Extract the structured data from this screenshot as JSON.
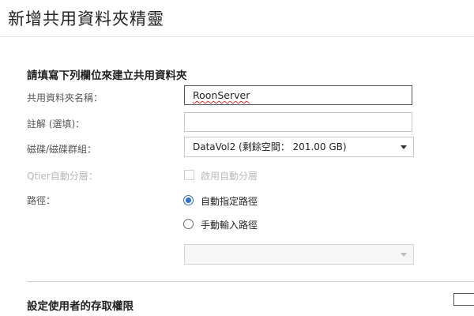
{
  "window": {
    "title": "新增共用資料夾精靈"
  },
  "form": {
    "section_title": "請填寫下列欄位來建立共用資料夾",
    "folder_name": {
      "label": "共用資料夾名稱：",
      "value": "RoonServer"
    },
    "comment": {
      "label": "註解 (選填)：",
      "value": ""
    },
    "disk": {
      "label": "磁碟/磁碟群組：",
      "selected": "DataVol2 (剩餘空間： 201.00 GB)"
    },
    "qtier": {
      "label": "Qtier自動分層：",
      "checkbox_label": "啟用自動分層",
      "checked": false,
      "enabled": false
    },
    "path": {
      "label": "路徑：",
      "options": [
        {
          "label": "自動指定路徑",
          "selected": true
        },
        {
          "label": "手動輸入路徑",
          "selected": false
        }
      ],
      "manual_path_value": ""
    }
  },
  "permissions": {
    "section_title": "設定使用者的存取權限"
  },
  "colors": {
    "radio_accent": "#2f6fd1",
    "spellcheck": "#e03030"
  }
}
